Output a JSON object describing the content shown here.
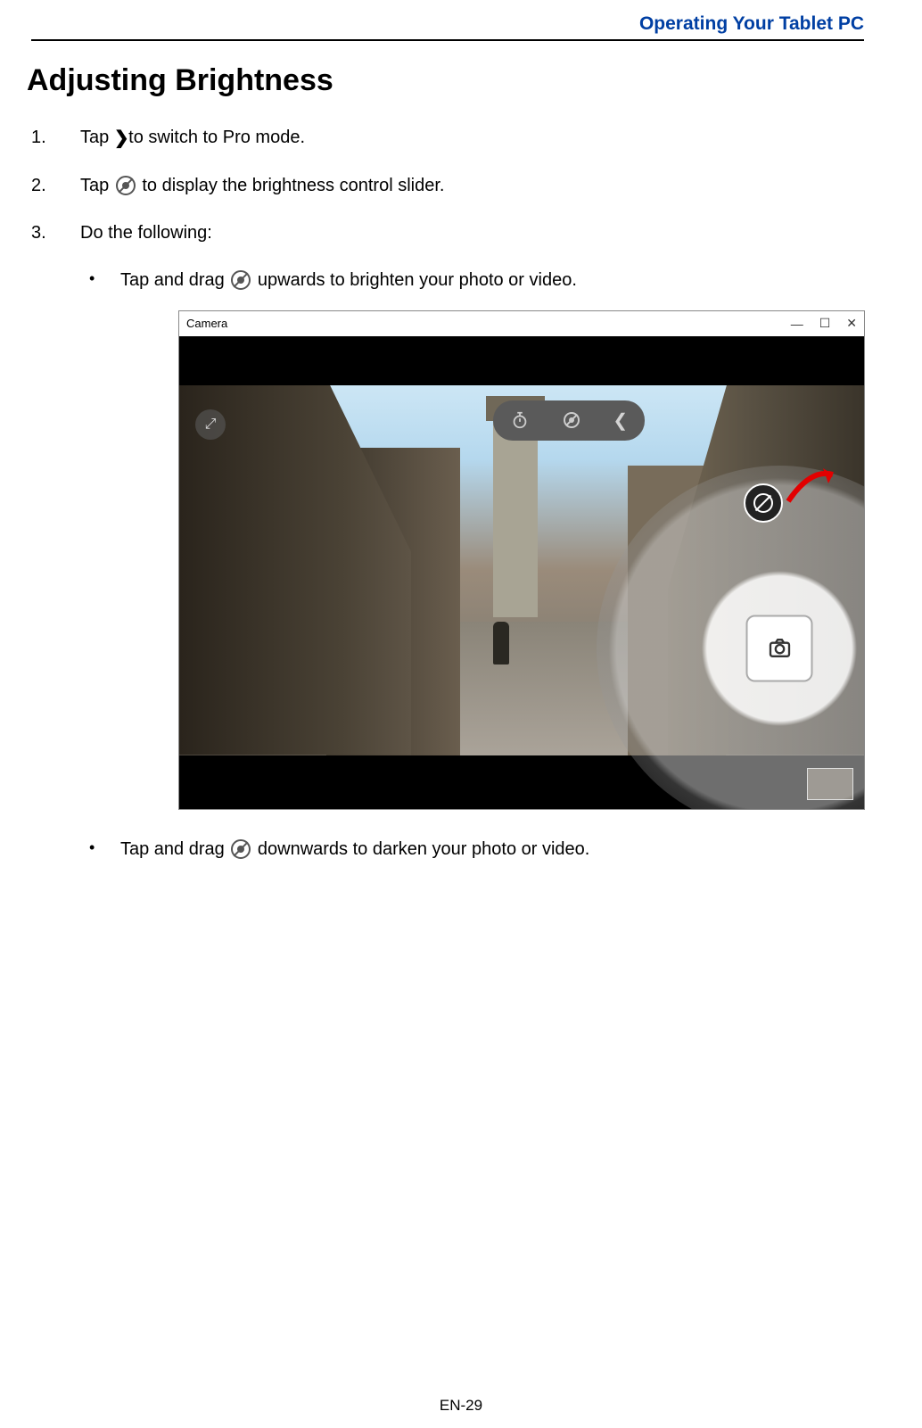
{
  "header": {
    "title": "Operating Your Tablet PC"
  },
  "section": {
    "heading": "Adjusting Brightness"
  },
  "steps": [
    {
      "num": "1.",
      "before": "Tap ",
      "icon": "chevron-right",
      "after": " to switch to Pro mode."
    },
    {
      "num": "2.",
      "before": "Tap ",
      "icon": "brightness",
      "after": " to display the brightness control slider."
    },
    {
      "num": "3.",
      "before": "Do the following:",
      "icon": "",
      "after": ""
    }
  ],
  "bullets": [
    {
      "before": "Tap and drag ",
      "icon": "brightness",
      "after": " upwards to brighten your photo or video."
    },
    {
      "before": "Tap and drag ",
      "icon": "brightness",
      "after": " downwards to darken your photo or video."
    }
  ],
  "window": {
    "title": "Camera",
    "controls": {
      "min": "—",
      "max": "☐",
      "close": "✕"
    }
  },
  "footer": {
    "page": "EN-29"
  }
}
